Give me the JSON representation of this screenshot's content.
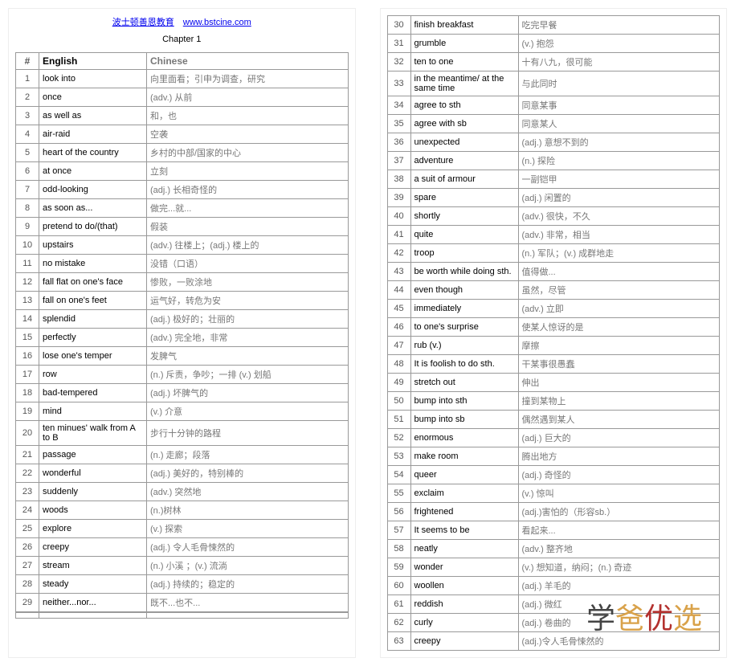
{
  "header": {
    "link1_text": "波士顿善恩教育",
    "link2_text": "www.bstcine.com",
    "chapter": "Chapter 1"
  },
  "table": {
    "head_num": "#",
    "head_eng": "English",
    "head_chi": "Chinese",
    "rows_left": [
      {
        "n": "1",
        "e": "look into",
        "c": "向里面看；引申为调查，研究"
      },
      {
        "n": "2",
        "e": "once",
        "c": "(adv.) 从前"
      },
      {
        "n": "3",
        "e": "as well as",
        "c": "和，也"
      },
      {
        "n": "4",
        "e": "air-raid",
        "c": "空袭"
      },
      {
        "n": "5",
        "e": "heart of the country",
        "c": "乡村的中部/国家的中心"
      },
      {
        "n": "6",
        "e": "at once",
        "c": "立刻"
      },
      {
        "n": "7",
        "e": "odd-looking",
        "c": "(adj.) 长相奇怪的"
      },
      {
        "n": "8",
        "e": "as soon as...",
        "c": "做完...就..."
      },
      {
        "n": "9",
        "e": "pretend to do/(that)",
        "c": "假装"
      },
      {
        "n": "10",
        "e": "upstairs",
        "c": "(adv.) 往楼上；(adj.) 楼上的"
      },
      {
        "n": "11",
        "e": "no mistake",
        "c": "没错（口语）"
      },
      {
        "n": "12",
        "e": "fall flat on one's face",
        "c": "惨败，一败涂地"
      },
      {
        "n": "13",
        "e": "fall on one's feet",
        "c": "运气好，转危为安"
      },
      {
        "n": "14",
        "e": "splendid",
        "c": "(adj.) 极好的；壮丽的"
      },
      {
        "n": "15",
        "e": "perfectly",
        "c": "(adv.) 完全地，非常"
      },
      {
        "n": "16",
        "e": "lose one's temper",
        "c": "发脾气"
      },
      {
        "n": "17",
        "e": "row",
        "c": "(n.) 斥责，争吵；一排 (v.) 划船"
      },
      {
        "n": "18",
        "e": "bad-tempered",
        "c": "(adj.) 坏脾气的"
      },
      {
        "n": "19",
        "e": "mind",
        "c": "(v.) 介意"
      },
      {
        "n": "20",
        "e": "ten minues' walk from A to B",
        "c": "步行十分钟的路程"
      },
      {
        "n": "21",
        "e": "passage",
        "c": "(n.) 走廊；段落"
      },
      {
        "n": "22",
        "e": "wonderful",
        "c": "(adj.) 美好的，特别棒的"
      },
      {
        "n": "23",
        "e": "suddenly",
        "c": "(adv.) 突然地"
      },
      {
        "n": "24",
        "e": "woods",
        "c": "(n.)树林"
      },
      {
        "n": "25",
        "e": "explore",
        "c": "(v.) 探索"
      },
      {
        "n": "26",
        "e": "creepy",
        "c": "(adj.) 令人毛骨悚然的"
      },
      {
        "n": "27",
        "e": "stream",
        "c": "(n.) 小溪 ；(v.) 流淌"
      },
      {
        "n": "28",
        "e": "steady",
        "c": "(adj.) 持续的；稳定的"
      },
      {
        "n": "29",
        "e": "neither...nor...",
        "c": "既不...也不..."
      }
    ],
    "rows_right": [
      {
        "n": "30",
        "e": "finish breakfast",
        "c": "吃完早餐"
      },
      {
        "n": "31",
        "e": "grumble",
        "c": "(v.) 抱怨"
      },
      {
        "n": "32",
        "e": "ten to one",
        "c": "十有八九，很可能"
      },
      {
        "n": "33",
        "e": "in the meantime/ at the same time",
        "c": "与此同时"
      },
      {
        "n": "34",
        "e": "agree to sth",
        "c": "同意某事"
      },
      {
        "n": "35",
        "e": "agree with sb",
        "c": "同意某人"
      },
      {
        "n": "36",
        "e": "unexpected",
        "c": "(adj.) 意想不到的"
      },
      {
        "n": "37",
        "e": "adventure",
        "c": "(n.) 探险"
      },
      {
        "n": "38",
        "e": "a suit of armour",
        "c": "一副铠甲"
      },
      {
        "n": "39",
        "e": "spare",
        "c": "(adj.) 闲置的"
      },
      {
        "n": "40",
        "e": "shortly",
        "c": "(adv.) 很快，不久"
      },
      {
        "n": "41",
        "e": "quite",
        "c": "(adv.) 非常，相当"
      },
      {
        "n": "42",
        "e": "troop",
        "c": "(n.) 军队；(v.) 成群地走"
      },
      {
        "n": "43",
        "e": "be worth while doing sth.",
        "c": "值得做..."
      },
      {
        "n": "44",
        "e": "even though",
        "c": "虽然，尽管"
      },
      {
        "n": "45",
        "e": "immediately",
        "c": "(adv.) 立即"
      },
      {
        "n": "46",
        "e": "to one's surprise",
        "c": "使某人惊讶的是"
      },
      {
        "n": "47",
        "e": "rub (v.)",
        "c": "摩擦"
      },
      {
        "n": "48",
        "e": "It is foolish to do sth.",
        "c": "干某事很愚蠢"
      },
      {
        "n": "49",
        "e": "stretch out",
        "c": "伸出"
      },
      {
        "n": "50",
        "e": "bump into sth",
        "c": "撞到某物上"
      },
      {
        "n": "51",
        "e": "bump into sb",
        "c": "偶然遇到某人"
      },
      {
        "n": "52",
        "e": "enormous",
        "c": "(adj.) 巨大的"
      },
      {
        "n": "53",
        "e": "make room",
        "c": "腾出地方"
      },
      {
        "n": "54",
        "e": "queer",
        "c": "(adj.) 奇怪的"
      },
      {
        "n": "55",
        "e": "exclaim",
        "c": "(v.) 惊叫"
      },
      {
        "n": "56",
        "e": "frightened",
        "c": "(adj.)害怕的（形容sb.）"
      },
      {
        "n": "57",
        "e": "It seems to be",
        "c": "看起来..."
      },
      {
        "n": "58",
        "e": "neatly",
        "c": "(adv.) 整齐地"
      },
      {
        "n": "59",
        "e": "wonder",
        "c": "(v.) 想知道，纳闷；(n.) 奇迹"
      },
      {
        "n": "60",
        "e": "woollen",
        "c": "(adj.) 羊毛的"
      },
      {
        "n": "61",
        "e": "reddish",
        "c": "(adj.) 微红"
      },
      {
        "n": "62",
        "e": "curly",
        "c": "(adj.) 卷曲的"
      },
      {
        "n": "63",
        "e": "creepy",
        "c": "(adj.)令人毛骨悚然的"
      }
    ]
  },
  "watermark": {
    "c1": "学",
    "c2": "爸",
    "c3": "优",
    "c4": "选"
  }
}
